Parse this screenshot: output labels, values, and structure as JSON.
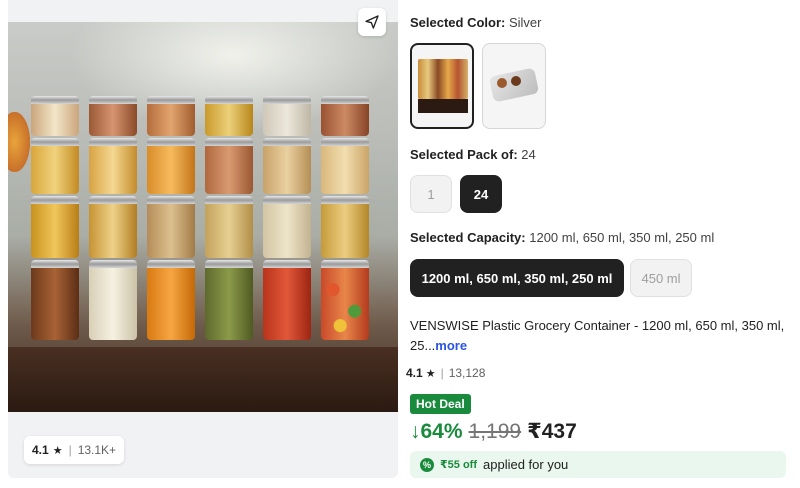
{
  "gallery": {
    "rating": "4.1",
    "rating_count": "13.1K+"
  },
  "color": {
    "label": "Selected Color:",
    "value": "Silver"
  },
  "pack": {
    "label": "Selected Pack of:",
    "value": "24",
    "options": [
      "1",
      "24"
    ]
  },
  "capacity": {
    "label": "Selected Capacity:",
    "value": "1200 ml, 650 ml, 350 ml, 250 ml",
    "options": [
      "1200 ml, 650 ml, 350 ml, 250 ml",
      "450 ml"
    ]
  },
  "product": {
    "title": "VENSWISE Plastic Grocery Container  - 1200 ml, 650 ml, 350 ml, 25...",
    "more_label": "more",
    "rating": "4.1",
    "rating_count": "13,128"
  },
  "deal": {
    "badge": "Hot Deal",
    "discount": "64%",
    "mrp": "1,199",
    "price": "₹437"
  },
  "offer": {
    "amount": "₹55 off",
    "text": "applied for you"
  }
}
